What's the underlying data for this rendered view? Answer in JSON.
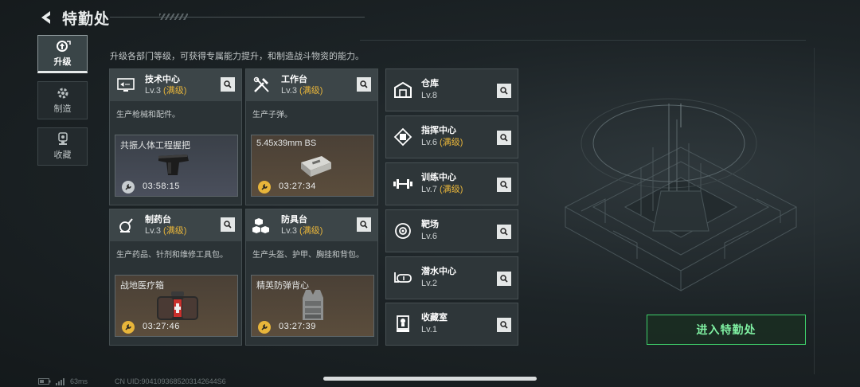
{
  "header": {
    "title": "特勤处"
  },
  "nav": [
    {
      "label": "升级",
      "icon": "upgrade-icon",
      "active": true
    },
    {
      "label": "制造",
      "icon": "gear-icon",
      "active": false
    },
    {
      "label": "收藏",
      "icon": "trophy-icon",
      "active": false
    }
  ],
  "description": "升级各部门等级，可获得专属能力提升，和制造战斗物资的能力。",
  "cards": [
    {
      "name": "技术中心",
      "level": "Lv.3",
      "max": "(满级)",
      "desc": "生产枪械和配件。",
      "slot": {
        "item": "共振人体工程握把",
        "timer": "03:58:15",
        "tone": "blue"
      }
    },
    {
      "name": "工作台",
      "level": "Lv.3",
      "max": "(满级)",
      "desc": "生产子弹。",
      "slot": {
        "item": "5.45x39mm BS",
        "timer": "03:27:34",
        "tone": "gold"
      }
    },
    {
      "name": "制药台",
      "level": "Lv.3",
      "max": "(满级)",
      "desc": "生产药品、针剂和维修工具包。",
      "slot": {
        "item": "战地医疗箱",
        "timer": "03:27:46",
        "tone": "gold"
      }
    },
    {
      "name": "防具台",
      "level": "Lv.3",
      "max": "(满级)",
      "desc": "生产头盔、护甲、胸挂和背包。",
      "slot": {
        "item": "精英防弹背心",
        "timer": "03:27:39",
        "tone": "gold"
      }
    }
  ],
  "facilities": [
    {
      "name": "仓库",
      "level": "Lv.8",
      "max": ""
    },
    {
      "name": "指挥中心",
      "level": "Lv.6",
      "max": "(满级)"
    },
    {
      "name": "训练中心",
      "level": "Lv.7",
      "max": "(满级)"
    },
    {
      "name": "靶场",
      "level": "Lv.6",
      "max": ""
    },
    {
      "name": "潜水中心",
      "level": "Lv.2",
      "max": ""
    },
    {
      "name": "收藏室",
      "level": "Lv.1",
      "max": ""
    }
  ],
  "enter_button": "进入特勤处",
  "footer": {
    "ping": "63ms",
    "uid": "CN UID:9041093685203142644S6"
  },
  "colors": {
    "maxed": "#e8b53a",
    "accent_green": "#3ecf6a"
  }
}
